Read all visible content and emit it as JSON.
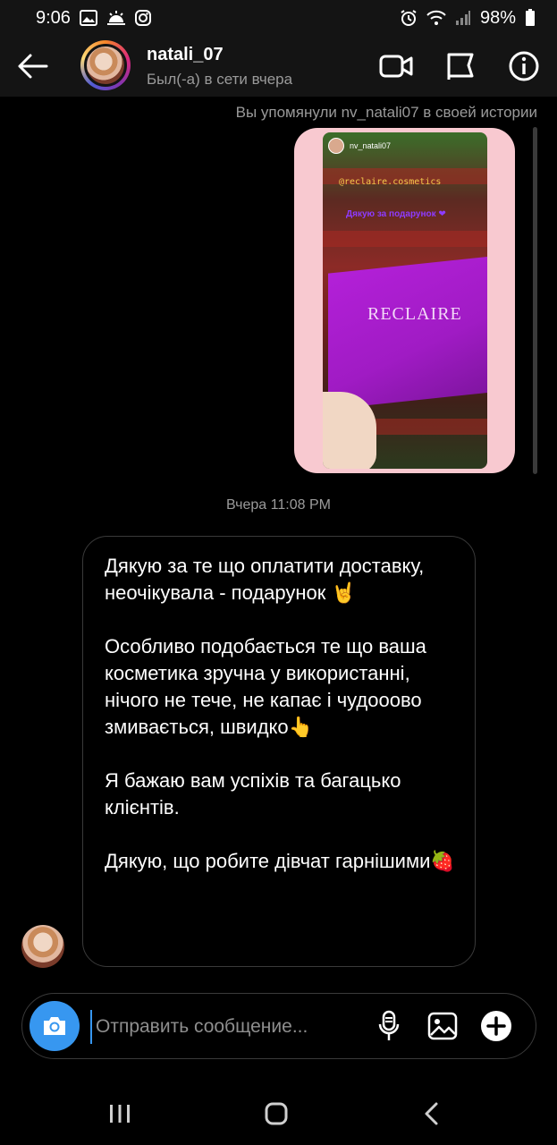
{
  "status_bar": {
    "time": "9:06",
    "battery": "98%",
    "left_icons": [
      "gallery-icon",
      "weather-icon",
      "instagram-icon"
    ],
    "right_icons": [
      "alarm-icon",
      "wifi-icon",
      "signal-icon",
      "battery-icon"
    ]
  },
  "header": {
    "username": "natali_07",
    "status": "Был(-а) в сети вчера",
    "actions": [
      "video-call-icon",
      "flag-icon",
      "info-icon"
    ]
  },
  "thread": {
    "mention_note": "Вы упомянули nv_natali07 в своей истории",
    "story": {
      "user": "nv_natali07",
      "mention": "@reclaire.cosmetics",
      "caption": "Дякую за подарунок ❤",
      "brand": "RECLAIRE"
    },
    "timestamp": "Вчера 11:08 PM",
    "message": {
      "p1": "Дякую за те що оплатити доставку, неочікувала - подарунок 🤘",
      "p2": "Особливо подобається те що ваша косметика зручна у використанні, нічого не тече, не капає і чудооово змивається, швидко👆",
      "p3": "Я бажаю вам успіхів та багацько клієнтів.",
      "p4": "Дякую, що робите дівчат гарнішими🍓"
    }
  },
  "composer": {
    "placeholder": "Отправить сообщение..."
  },
  "colors": {
    "accent": "#3797f0",
    "background": "#000000",
    "header_bg": "#141414",
    "story_border": "#f8c9d0"
  }
}
